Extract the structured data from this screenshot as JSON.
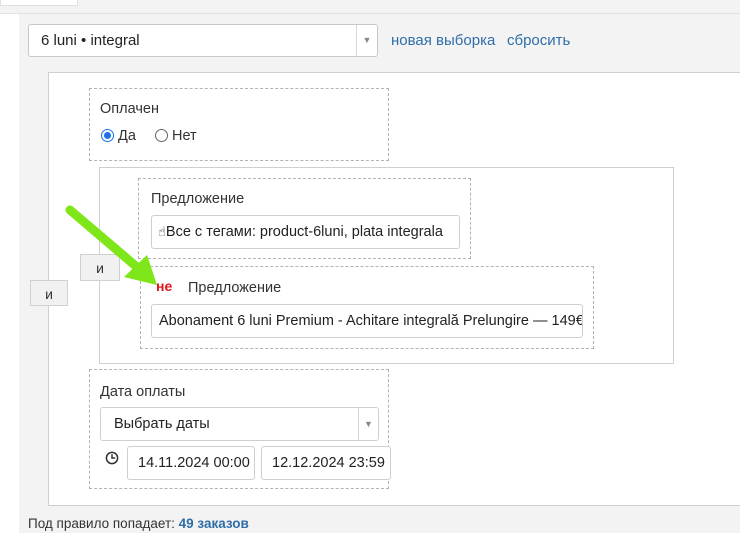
{
  "filter": {
    "selected_preset": "6 luni • integral",
    "new_selection_link": "новая выборка",
    "reset_link": "сбросить"
  },
  "rule": {
    "outer_operator": "и",
    "paid": {
      "label": "Оплачен",
      "options": [
        "Да",
        "Нет"
      ],
      "selected": "Да"
    },
    "offer_group": {
      "operator": "и",
      "offer_tags": {
        "label": "Предложение",
        "value": "Все с тегами: product-6luni, plata integrala",
        "icon": "hand-pointer-icon"
      },
      "offer_excluded": {
        "negation": "не",
        "label": "Предложение",
        "value": "Abonament 6 luni Premium - Achitare integrală Prelungire — 149€"
      }
    },
    "payment_date": {
      "label": "Дата оплаты",
      "select_placeholder": "Выбрать даты",
      "from": "14.11.2024 00:00",
      "to": "12.12.2024 23:59",
      "icon": "clock-icon"
    }
  },
  "summary": {
    "prefix": "Под правило попадает:",
    "count_text": "49 заказов"
  },
  "annotation": {
    "arrow_color": "#7fe61a"
  }
}
